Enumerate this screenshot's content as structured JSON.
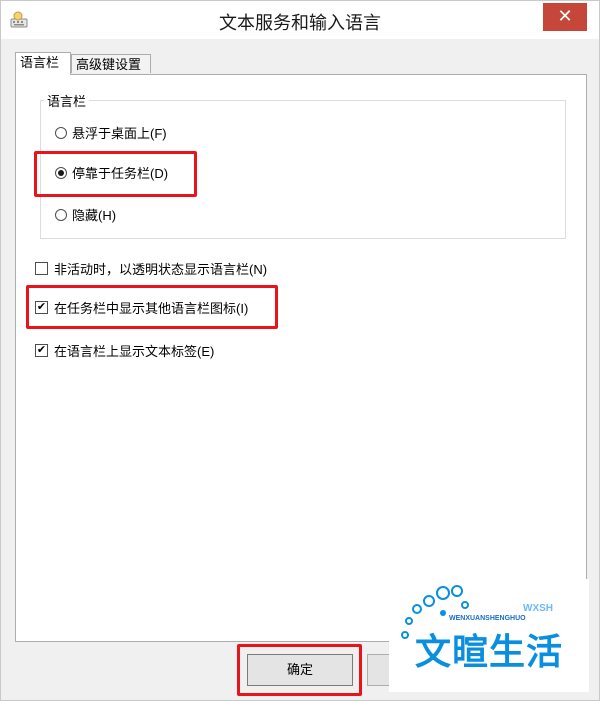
{
  "window": {
    "title": "文本服务和输入语言"
  },
  "tabs": [
    {
      "label": "语言栏",
      "active": true
    },
    {
      "label": "高级键设置",
      "active": false
    }
  ],
  "language_bar": {
    "group_label": "语言栏",
    "options": [
      {
        "label": "悬浮于桌面上(F)",
        "selected": false
      },
      {
        "label": "停靠于任务栏(D)",
        "selected": true
      },
      {
        "label": "隐藏(H)",
        "selected": false
      }
    ]
  },
  "checkboxes": [
    {
      "label": "非活动时，以透明状态显示语言栏(N)",
      "checked": false
    },
    {
      "label": "在任务栏中显示其他语言栏图标(I)",
      "checked": true
    },
    {
      "label": "在语言栏上显示文本标签(E)",
      "checked": true
    }
  ],
  "buttons": {
    "ok": "确定"
  },
  "watermark": {
    "text": "文暄生活",
    "sub": "WENXUANSHENGHUO",
    "abbr": "WXSH"
  },
  "colors": {
    "highlight": "#e8141c",
    "close": "#c7463a",
    "watermark": "#0a8fe0"
  }
}
